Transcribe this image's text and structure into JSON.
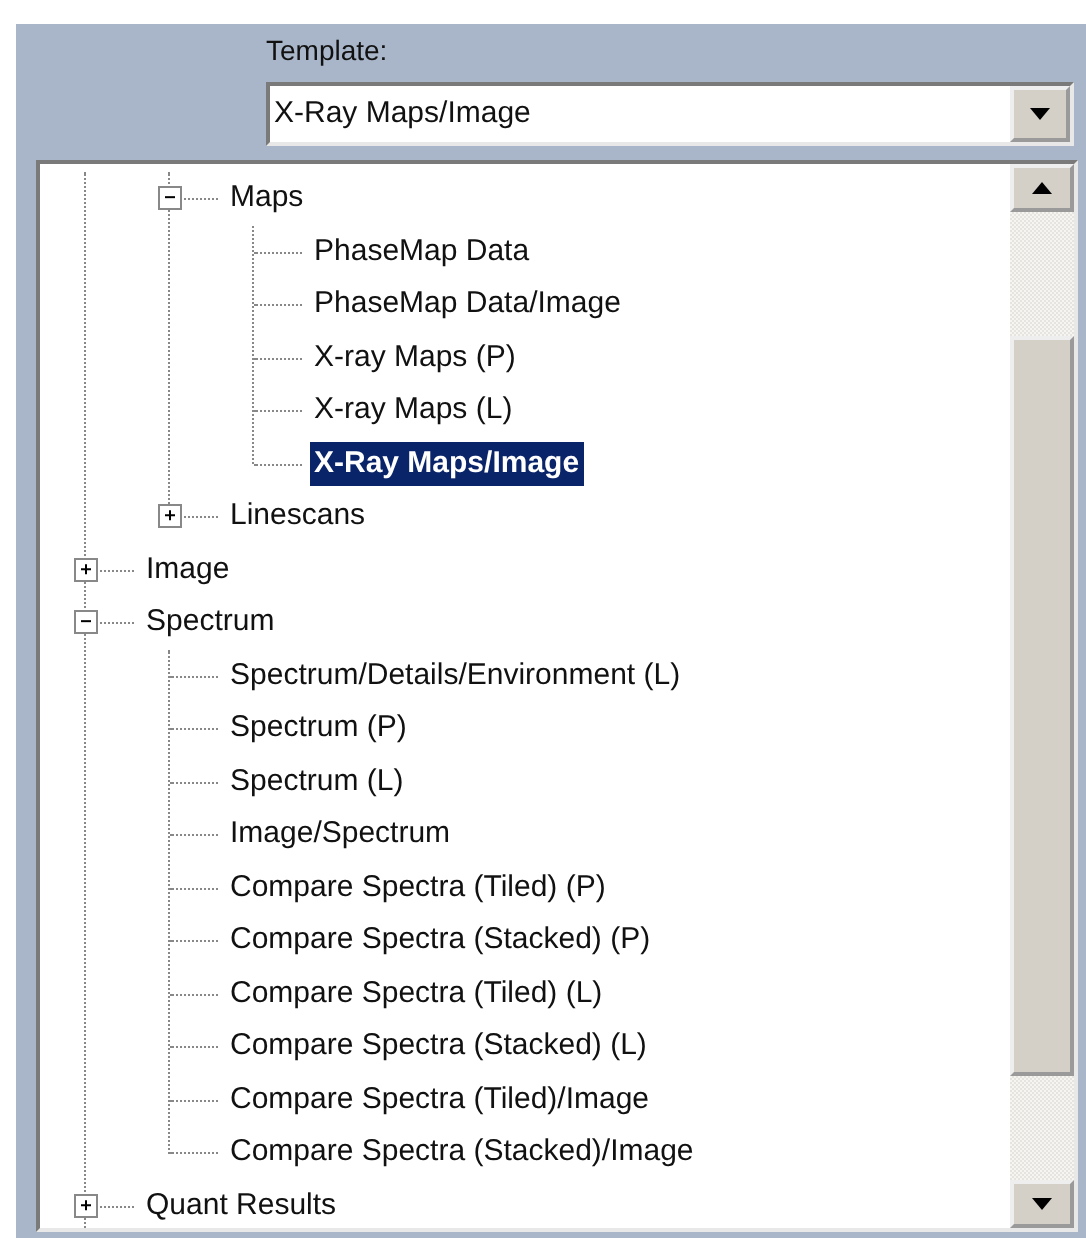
{
  "template": {
    "label": "Template:",
    "value": "X-Ray Maps/Image"
  },
  "tree": [
    {
      "kind": "offscreen",
      "children": [
        {
          "label": "Maps",
          "expanded": true,
          "selected": false,
          "children": [
            {
              "label": "PhaseMap Data",
              "selected": false
            },
            {
              "label": "PhaseMap Data/Image",
              "selected": false
            },
            {
              "label": "X-ray Maps (P)",
              "selected": false
            },
            {
              "label": "X-ray Maps (L)",
              "selected": false
            },
            {
              "label": "X-Ray Maps/Image",
              "selected": true
            }
          ]
        },
        {
          "label": "Linescans",
          "expanded": false,
          "selected": false
        }
      ]
    },
    {
      "label": "Image",
      "expanded": false,
      "selected": false
    },
    {
      "label": "Spectrum",
      "expanded": true,
      "selected": false,
      "children": [
        {
          "label": "Spectrum/Details/Environment (L)",
          "selected": false
        },
        {
          "label": "Spectrum (P)",
          "selected": false
        },
        {
          "label": "Spectrum (L)",
          "selected": false
        },
        {
          "label": "Image/Spectrum",
          "selected": false
        },
        {
          "label": "Compare Spectra (Tiled) (P)",
          "selected": false
        },
        {
          "label": "Compare Spectra (Stacked) (P)",
          "selected": false
        },
        {
          "label": "Compare Spectra (Tiled) (L)",
          "selected": false
        },
        {
          "label": "Compare Spectra (Stacked) (L)",
          "selected": false
        },
        {
          "label": "Compare Spectra (Tiled)/Image",
          "selected": false
        },
        {
          "label": "Compare Spectra (Stacked)/Image",
          "selected": false
        }
      ]
    },
    {
      "label": "Quant Results",
      "expanded": false,
      "selected": false
    }
  ]
}
